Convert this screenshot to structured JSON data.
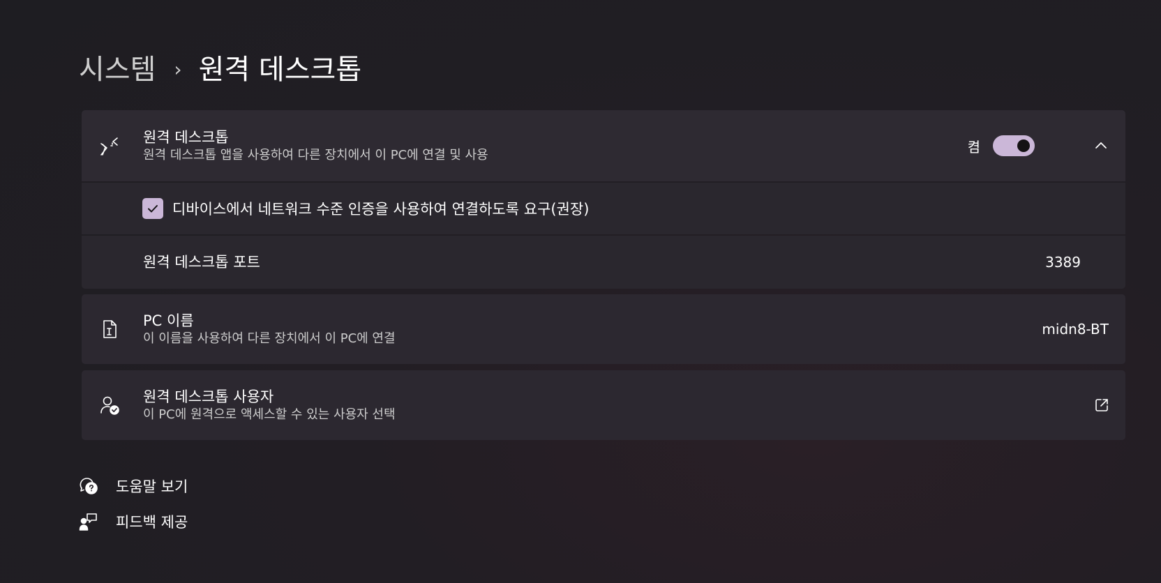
{
  "breadcrumb": {
    "parent": "시스템",
    "separator": "›",
    "current": "원격 데스크톱"
  },
  "remote_desktop": {
    "icon": "remote-desktop-icon",
    "title": "원격 데스크톱",
    "description": "원격 데스크톱 앱을 사용하여 다른 장치에서 이 PC에 연결 및 사용",
    "toggle_label": "켬",
    "toggle_on": true,
    "expanded": true,
    "nla_checkbox_label": "디바이스에서 네트워크 수준 인증을 사용하여 연결하도록 요구(권장)",
    "nla_checked": true,
    "port_label": "원격 데스크톱 포트",
    "port_value": "3389"
  },
  "pc_name": {
    "icon": "pc-name-icon",
    "title": "PC 이름",
    "description": "이 이름을 사용하여 다른 장치에서 이 PC에 연결",
    "value": "midn8-BT"
  },
  "remote_users": {
    "icon": "user-check-icon",
    "title": "원격 데스크톱 사용자",
    "description": "이 PC에 원격으로 액세스할 수 있는 사용자 선택",
    "action_icon": "open-external-icon"
  },
  "links": {
    "help": "도움말 보기",
    "feedback": "피드백 제공"
  },
  "colors": {
    "accent": "#cbb7d8",
    "card": "#2c2830",
    "background": "#1e1d22"
  }
}
